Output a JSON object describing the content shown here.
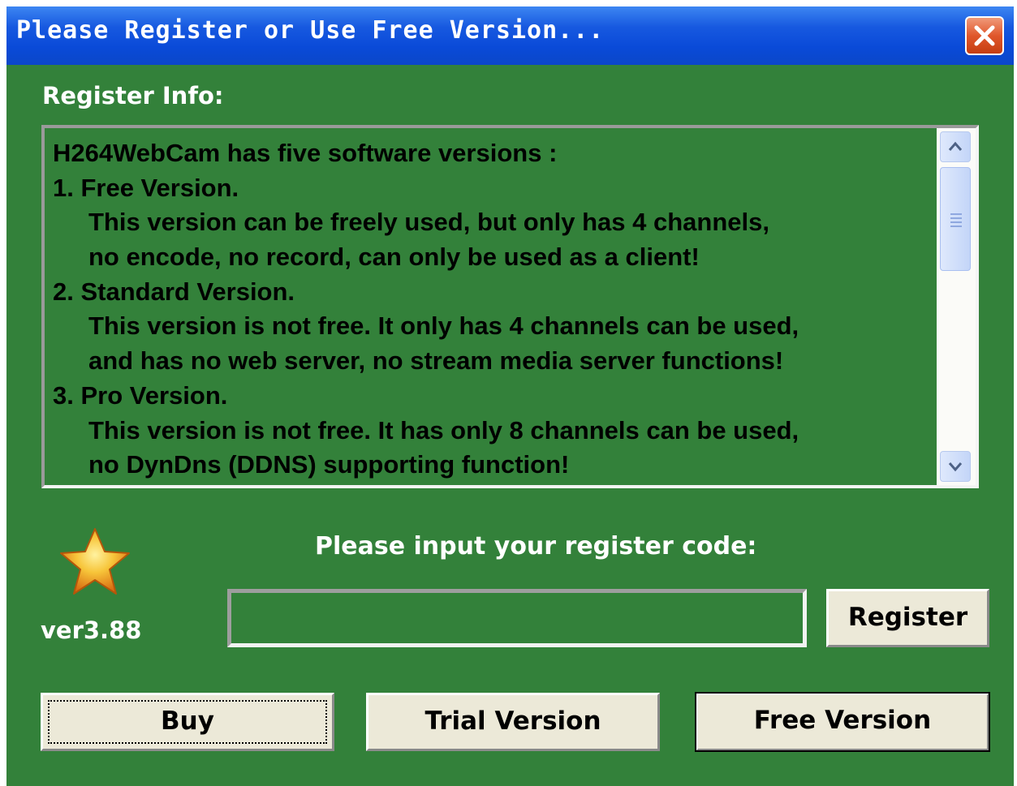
{
  "window": {
    "title": "Please Register or Use Free Version...",
    "close_icon": "close-icon"
  },
  "register_info": {
    "label": "Register Info:",
    "lines": [
      "H264WebCam has five software versions :",
      "1. Free Version.",
      "This version can be freely used, but only has 4 channels,",
      "no encode, no record, can only be used as a client!",
      "2. Standard Version.",
      "This version is not free. It only has 4 channels can be used,",
      "and has no web server, no stream media server functions!",
      "3. Pro Version.",
      "This version is not free. It has only 8 channels can be used,",
      "no DynDns (DDNS) supporting function!"
    ]
  },
  "version": {
    "icon": "star-icon",
    "label": "ver3.88"
  },
  "registration": {
    "prompt": "Please input your register code:",
    "code_value": "",
    "register_button": "Register"
  },
  "buttons": {
    "buy": "Buy",
    "trial": "Trial Version",
    "free": "Free Version"
  },
  "colors": {
    "dialog_background": "#33813a",
    "titlebar": "#0a4ad8",
    "button_face": "#ece9d8"
  }
}
